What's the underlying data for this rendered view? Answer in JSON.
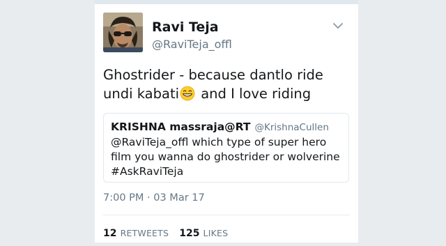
{
  "tweet": {
    "author_name": "Ravi Teja",
    "author_handle": "@RaviTeja_offl",
    "text_before_emoji": "Ghostrider - because dantlo ride undi kabati",
    "text_after_emoji": " and I love riding",
    "emoji_icon": "grinning-face-emoji",
    "timestamp": "7:00 PM · 03 Mar 17"
  },
  "quoted": {
    "author_name": "KRISHNA massraja@RT",
    "author_handle": "@KrishnaCullen",
    "text": "@RaviTeja_offl which type of super hero film you wanna do ghostrider or wolverine #AskRaviTeja"
  },
  "stats": {
    "retweets_count": "12",
    "retweets_label": "RETWEETS",
    "likes_count": "125",
    "likes_label": "LIKES"
  },
  "colors": {
    "background": "#e9ecef",
    "text_primary": "#14171a",
    "text_secondary": "#657786",
    "border": "#e1e8ed"
  }
}
